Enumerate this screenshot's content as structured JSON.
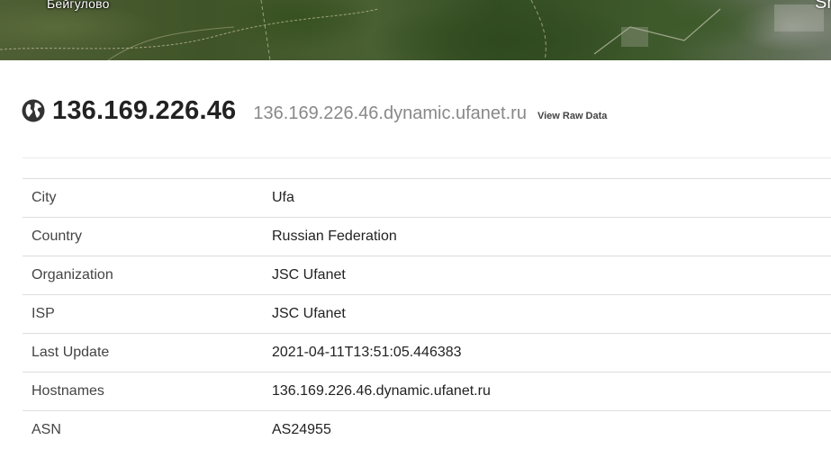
{
  "map": {
    "place_label": "Бейгулово",
    "edge_label": "Sh"
  },
  "header": {
    "icon": "globe-icon",
    "ip": "136.169.226.46",
    "hostname": "136.169.226.46.dynamic.ufanet.ru",
    "raw_data_link": "View Raw Data"
  },
  "details": [
    {
      "key": "City",
      "value": "Ufa"
    },
    {
      "key": "Country",
      "value": "Russian Federation"
    },
    {
      "key": "Organization",
      "value": "JSC Ufanet"
    },
    {
      "key": "ISP",
      "value": "JSC Ufanet"
    },
    {
      "key": "Last Update",
      "value": "2021-04-11T13:51:05.446383"
    },
    {
      "key": "Hostnames",
      "value": "136.169.226.46.dynamic.ufanet.ru"
    },
    {
      "key": "ASN",
      "value": "AS24955"
    }
  ]
}
